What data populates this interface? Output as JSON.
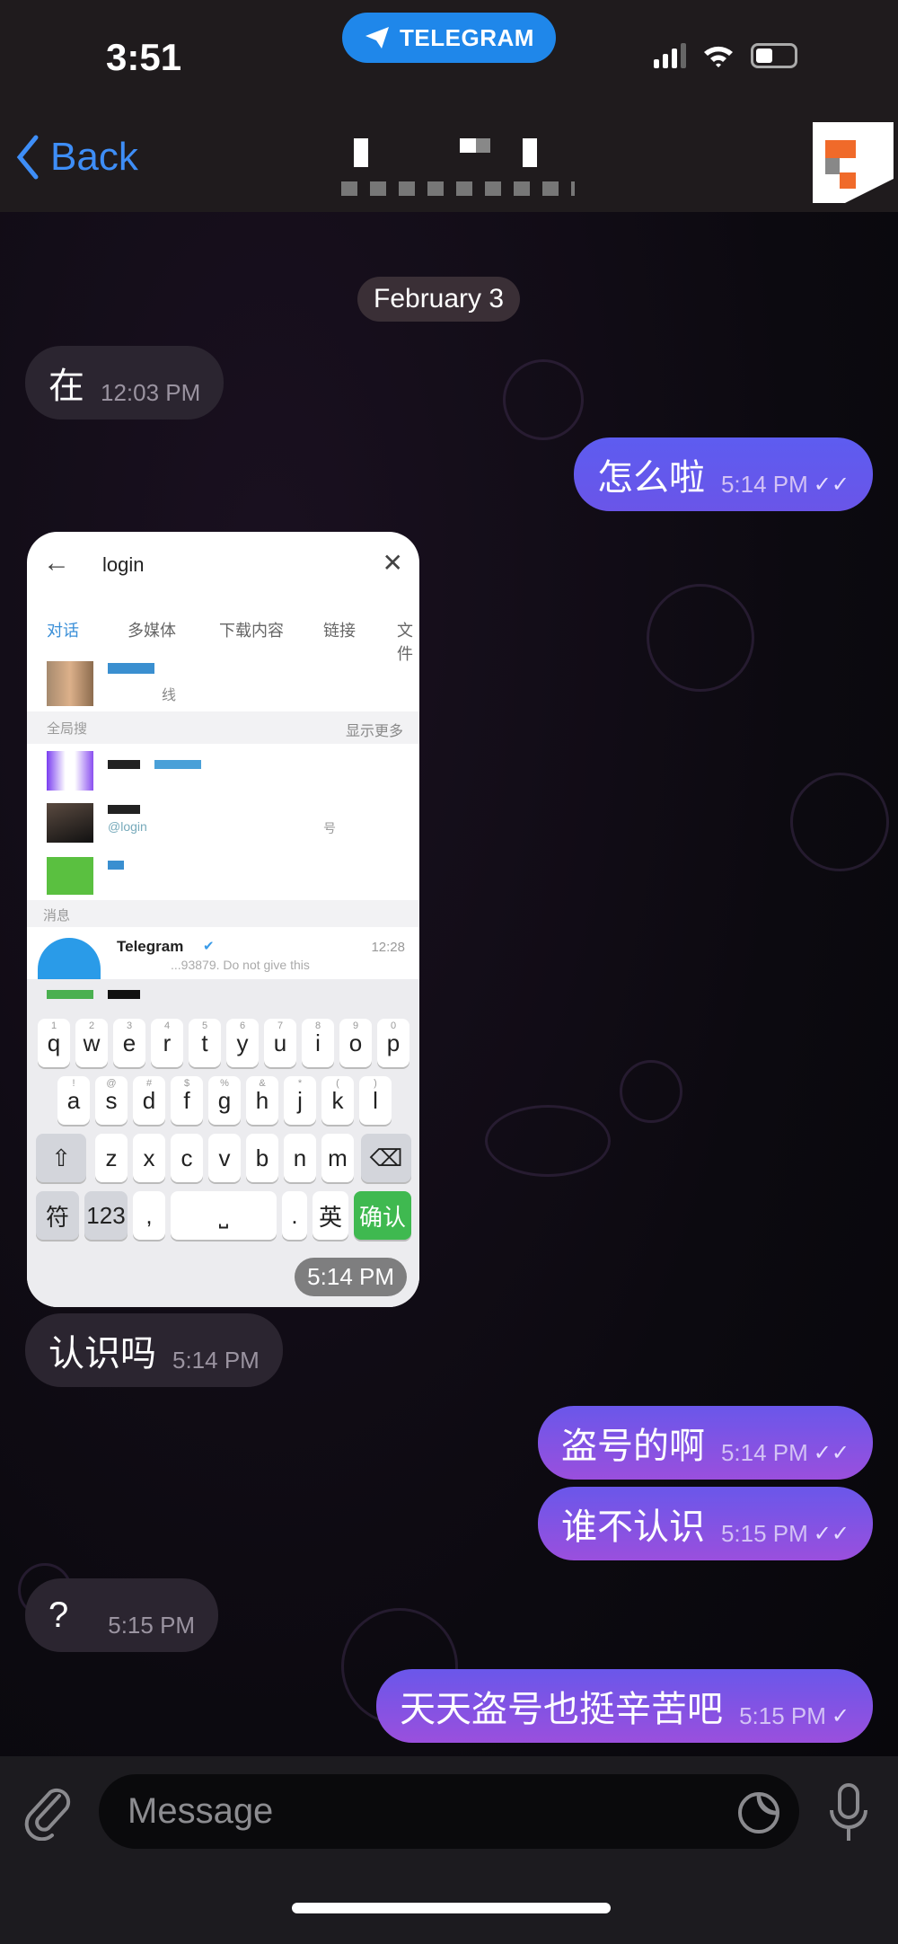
{
  "status_bar": {
    "time": "3:51",
    "app_pill": "TELEGRAM"
  },
  "nav": {
    "back_label": "Back"
  },
  "chat": {
    "date": "February 3",
    "messages": [
      {
        "dir": "in",
        "text": "在",
        "time": "12:03 PM"
      },
      {
        "dir": "out",
        "text": "怎么啦",
        "time": "5:14 PM",
        "status": "read"
      },
      {
        "dir": "in",
        "type": "image",
        "time": "5:14 PM"
      },
      {
        "dir": "in",
        "text": "认识吗",
        "time": "5:14 PM"
      },
      {
        "dir": "out",
        "text": "盗号的啊",
        "time": "5:14 PM",
        "status": "read"
      },
      {
        "dir": "out",
        "text": "谁不认识",
        "time": "5:15 PM",
        "status": "read"
      },
      {
        "dir": "in",
        "text": "?",
        "time": "5:15 PM"
      },
      {
        "dir": "out",
        "text": "天天盗号也挺辛苦吧",
        "time": "5:15 PM",
        "status": "sent"
      }
    ],
    "checks": {
      "read": "✓✓",
      "sent": "✓"
    }
  },
  "screenshot": {
    "search_query": "login",
    "tabs": [
      "对话",
      "多媒体",
      "下载内容",
      "链接",
      "文件"
    ],
    "result1_sub": "线",
    "section_global": "全局搜",
    "show_more": "显示更多",
    "handle_partial": "@login",
    "handle_tail": "号",
    "section_messages": "消息",
    "msg_sender": "Telegram",
    "msg_time": "12:28",
    "msg_preview": "...93879. Do not give this",
    "keys_row1": [
      "q",
      "w",
      "e",
      "r",
      "t",
      "y",
      "u",
      "i",
      "o",
      "p"
    ],
    "keys_row1_sup": [
      "1",
      "2",
      "3",
      "4",
      "5",
      "6",
      "7",
      "8",
      "9",
      "0"
    ],
    "keys_row2": [
      "a",
      "s",
      "d",
      "f",
      "g",
      "h",
      "j",
      "k",
      "l"
    ],
    "keys_row2_sup": [
      "!",
      "@",
      "#",
      "$",
      "%",
      "&",
      "*",
      "(",
      ")"
    ],
    "keys_row3": [
      "z",
      "x",
      "c",
      "v",
      "b",
      "n",
      "m"
    ],
    "key_symbols": "符",
    "key_123": "123",
    "key_comma": ",",
    "key_period": ".",
    "key_lang": "英",
    "key_confirm": "确认"
  },
  "composer": {
    "placeholder": "Message"
  },
  "colors": {
    "accent": "#3e8ef7",
    "pill": "#1f87ea",
    "out_bubble_top": "#6a57ea",
    "out_bubble_bottom": "#9a4fdd",
    "in_bubble": "#2b2530"
  }
}
